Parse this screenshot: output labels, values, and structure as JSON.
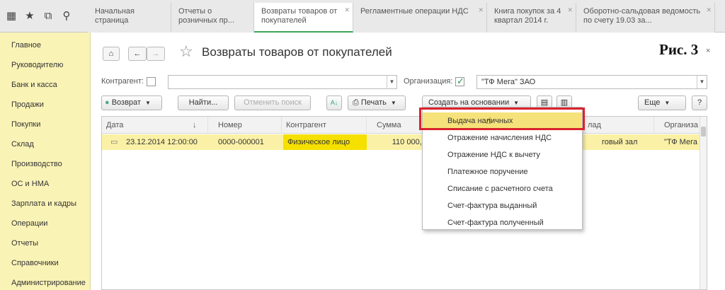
{
  "topbar": {
    "icons": [
      "apps-grid-icon",
      "star-icon",
      "history-icon",
      "search-icon"
    ],
    "tabs": [
      {
        "label": "Начальная страница"
      },
      {
        "label": "Отчеты о розничных пр..."
      },
      {
        "label": "Возвраты товаров от покупателей"
      },
      {
        "label": "Регламентные операции НДС"
      },
      {
        "label": "Книга покупок за 4 квартал 2014 г."
      },
      {
        "label": "Оборотно-сальдовая ведомость по счету 19.03 за..."
      }
    ]
  },
  "sidebar": {
    "items": [
      {
        "label": "Главное"
      },
      {
        "label": "Руководителю"
      },
      {
        "label": "Банк и касса"
      },
      {
        "label": "Продажи"
      },
      {
        "label": "Покупки"
      },
      {
        "label": "Склад"
      },
      {
        "label": "Производство"
      },
      {
        "label": "ОС и НМА"
      },
      {
        "label": "Зарплата и кадры"
      },
      {
        "label": "Операции"
      },
      {
        "label": "Отчеты"
      },
      {
        "label": "Справочники"
      },
      {
        "label": "Администрирование"
      }
    ]
  },
  "header": {
    "home_icon": "⌂",
    "back_icon": "←",
    "forward_icon": "→",
    "star_icon": "☆",
    "title": "Возвраты товаров от покупателей",
    "annotation": "Рис. 3",
    "close_icon": "×"
  },
  "filters": {
    "counterparty_label": "Контрагент:",
    "counterparty_checked": false,
    "counterparty_value": "",
    "organization_label": "Организация:",
    "organization_checked": true,
    "organization_value": "\"ТФ Мега\" ЗАО"
  },
  "toolbar": {
    "return_button": "Возврат",
    "find_button": "Найти...",
    "cancel_search_button": "Отменить поиск",
    "print_button": "Печать",
    "create_based_button": "Создать на основании",
    "more_button": "Еще",
    "help_button": "?",
    "dropdown_arrow": "▼"
  },
  "table": {
    "columns": [
      "Дата",
      "Номер",
      "Контрагент",
      "Сумма",
      "лад",
      "Организа"
    ],
    "sort_indicator": "↓",
    "rows": [
      {
        "date": "23.12.2014 12:00:00",
        "number": "0000-000001",
        "counterparty": "Физическое лицо",
        "sum": "110 000,00",
        "warehouse": "говый зал",
        "organization": "\"ТФ Мега"
      }
    ]
  },
  "menu": {
    "items": [
      {
        "label": "Выдача наличных",
        "selected": true
      },
      {
        "label": "Отражение начисления НДС",
        "selected": false
      },
      {
        "label": "Отражение НДС к вычету",
        "selected": false
      },
      {
        "label": "Платежное поручение",
        "selected": false
      },
      {
        "label": "Списание с расчетного счета",
        "selected": false
      },
      {
        "label": "Счет-фактура выданный",
        "selected": false
      },
      {
        "label": "Счет-фактура полученный",
        "selected": false
      }
    ]
  },
  "colors": {
    "sidebar_bg": "#faf3b6",
    "row_highlight": "#fbf1a6",
    "cell_highlight": "#f5e000",
    "menu_selected": "#f6e27a",
    "annotation_box": "#d9232e",
    "active_tab_accent": "#3fa35a"
  }
}
